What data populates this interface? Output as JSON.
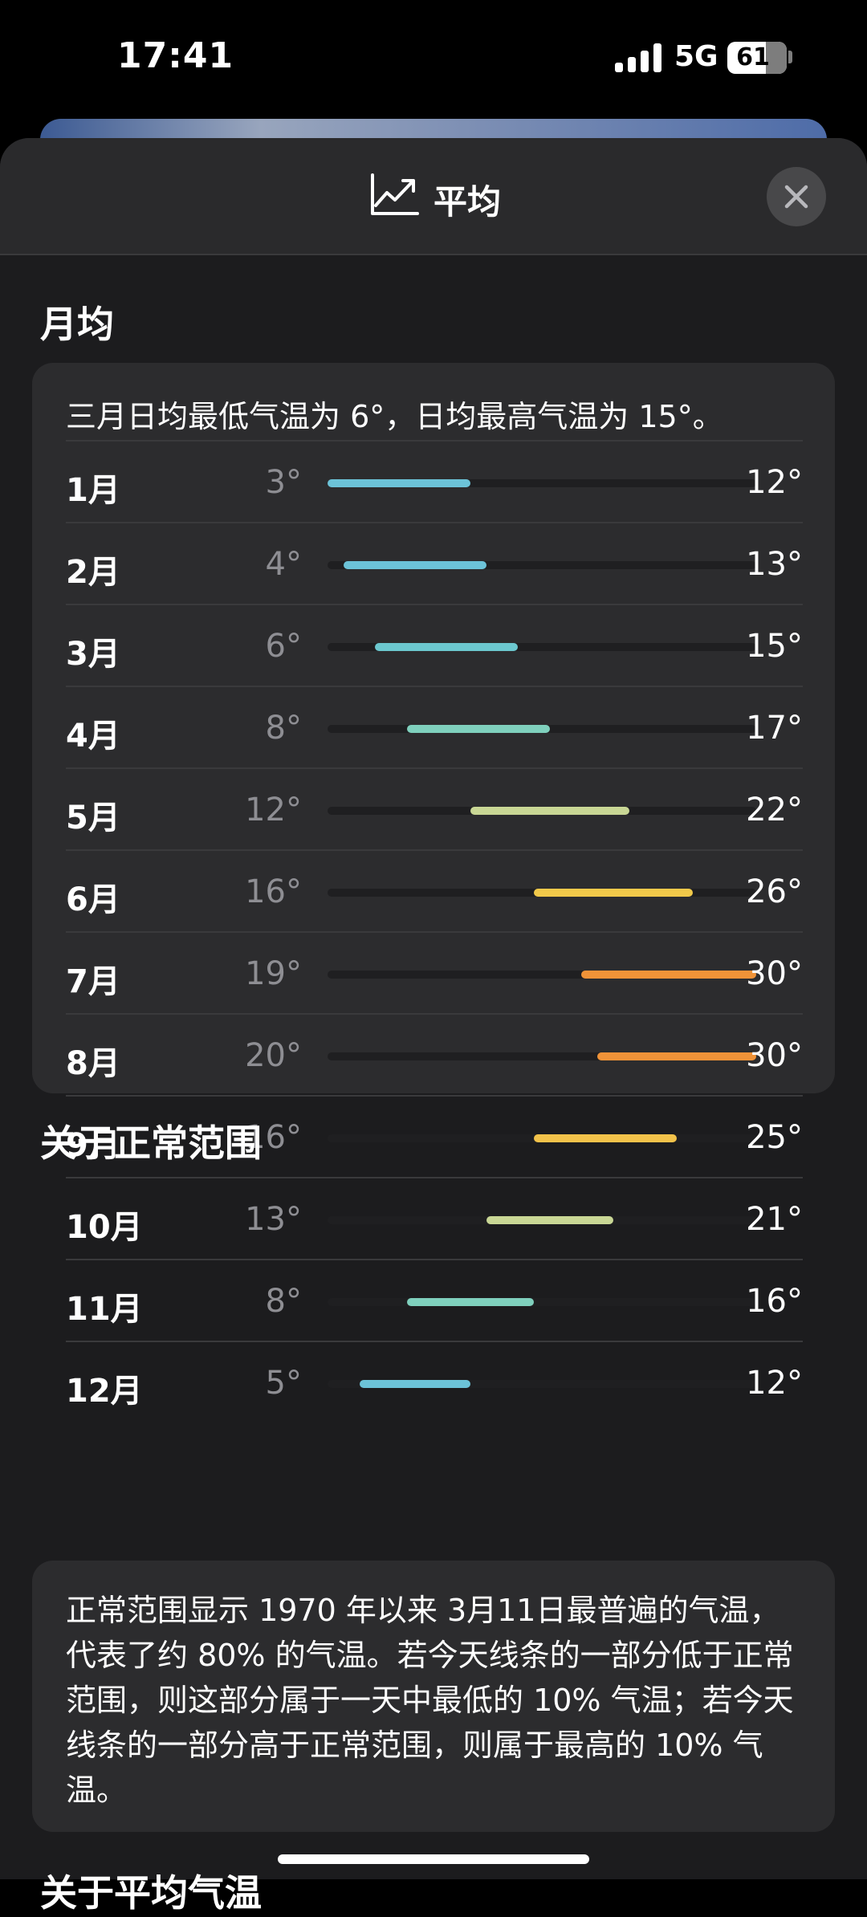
{
  "status_bar": {
    "time": "17:41",
    "network": "5G",
    "battery": "61"
  },
  "header": {
    "title": "平均",
    "icon": "chart-trend-icon",
    "close_icon": "close-icon"
  },
  "monthly": {
    "section_title": "月均",
    "summary": "三月日均最低气温为 6°，日均最高气温为 15°。",
    "scale_min": 3,
    "scale_max": 30,
    "months": [
      {
        "month": "1月",
        "low": "3°",
        "high": "12°",
        "low_val": 3,
        "high_val": 12,
        "color": "#6cc3d8"
      },
      {
        "month": "2月",
        "low": "4°",
        "high": "13°",
        "low_val": 4,
        "high_val": 13,
        "color": "#6cc3d8"
      },
      {
        "month": "3月",
        "low": "6°",
        "high": "15°",
        "low_val": 6,
        "high_val": 15,
        "color": "#6cc8cf"
      },
      {
        "month": "4月",
        "low": "8°",
        "high": "17°",
        "low_val": 8,
        "high_val": 17,
        "color": "#7fd0bd"
      },
      {
        "month": "5月",
        "low": "12°",
        "high": "22°",
        "low_val": 12,
        "high_val": 22,
        "color": "#c9d795"
      },
      {
        "month": "6月",
        "low": "16°",
        "high": "26°",
        "low_val": 16,
        "high_val": 26,
        "color": "#f1c94a"
      },
      {
        "month": "7月",
        "low": "19°",
        "high": "30°",
        "low_val": 19,
        "high_val": 30,
        "color": "#f09338"
      },
      {
        "month": "8月",
        "low": "20°",
        "high": "30°",
        "low_val": 20,
        "high_val": 30,
        "color": "#f09338"
      },
      {
        "month": "9月",
        "low": "16°",
        "high": "25°",
        "low_val": 16,
        "high_val": 25,
        "color": "#f2c24a"
      },
      {
        "month": "10月",
        "low": "13°",
        "high": "21°",
        "low_val": 13,
        "high_val": 21,
        "color": "#c9d795"
      },
      {
        "month": "11月",
        "low": "8°",
        "high": "16°",
        "low_val": 8,
        "high_val": 16,
        "color": "#7fd0bd"
      },
      {
        "month": "12月",
        "low": "5°",
        "high": "12°",
        "low_val": 5,
        "high_val": 12,
        "color": "#6cc3d8"
      }
    ]
  },
  "about": {
    "section_title": "关于正常范围",
    "text": "正常范围显示 1970 年以来 3月11日最普遍的气温，代表了约 80% 的气温。若今天线条的一部分低于正常范围，则这部分属于一天中最低的 10% 气温；若今天线条的一部分高于正常范围，则属于最高的 10% 气温。"
  },
  "next_section_title": "关于平均气温"
}
